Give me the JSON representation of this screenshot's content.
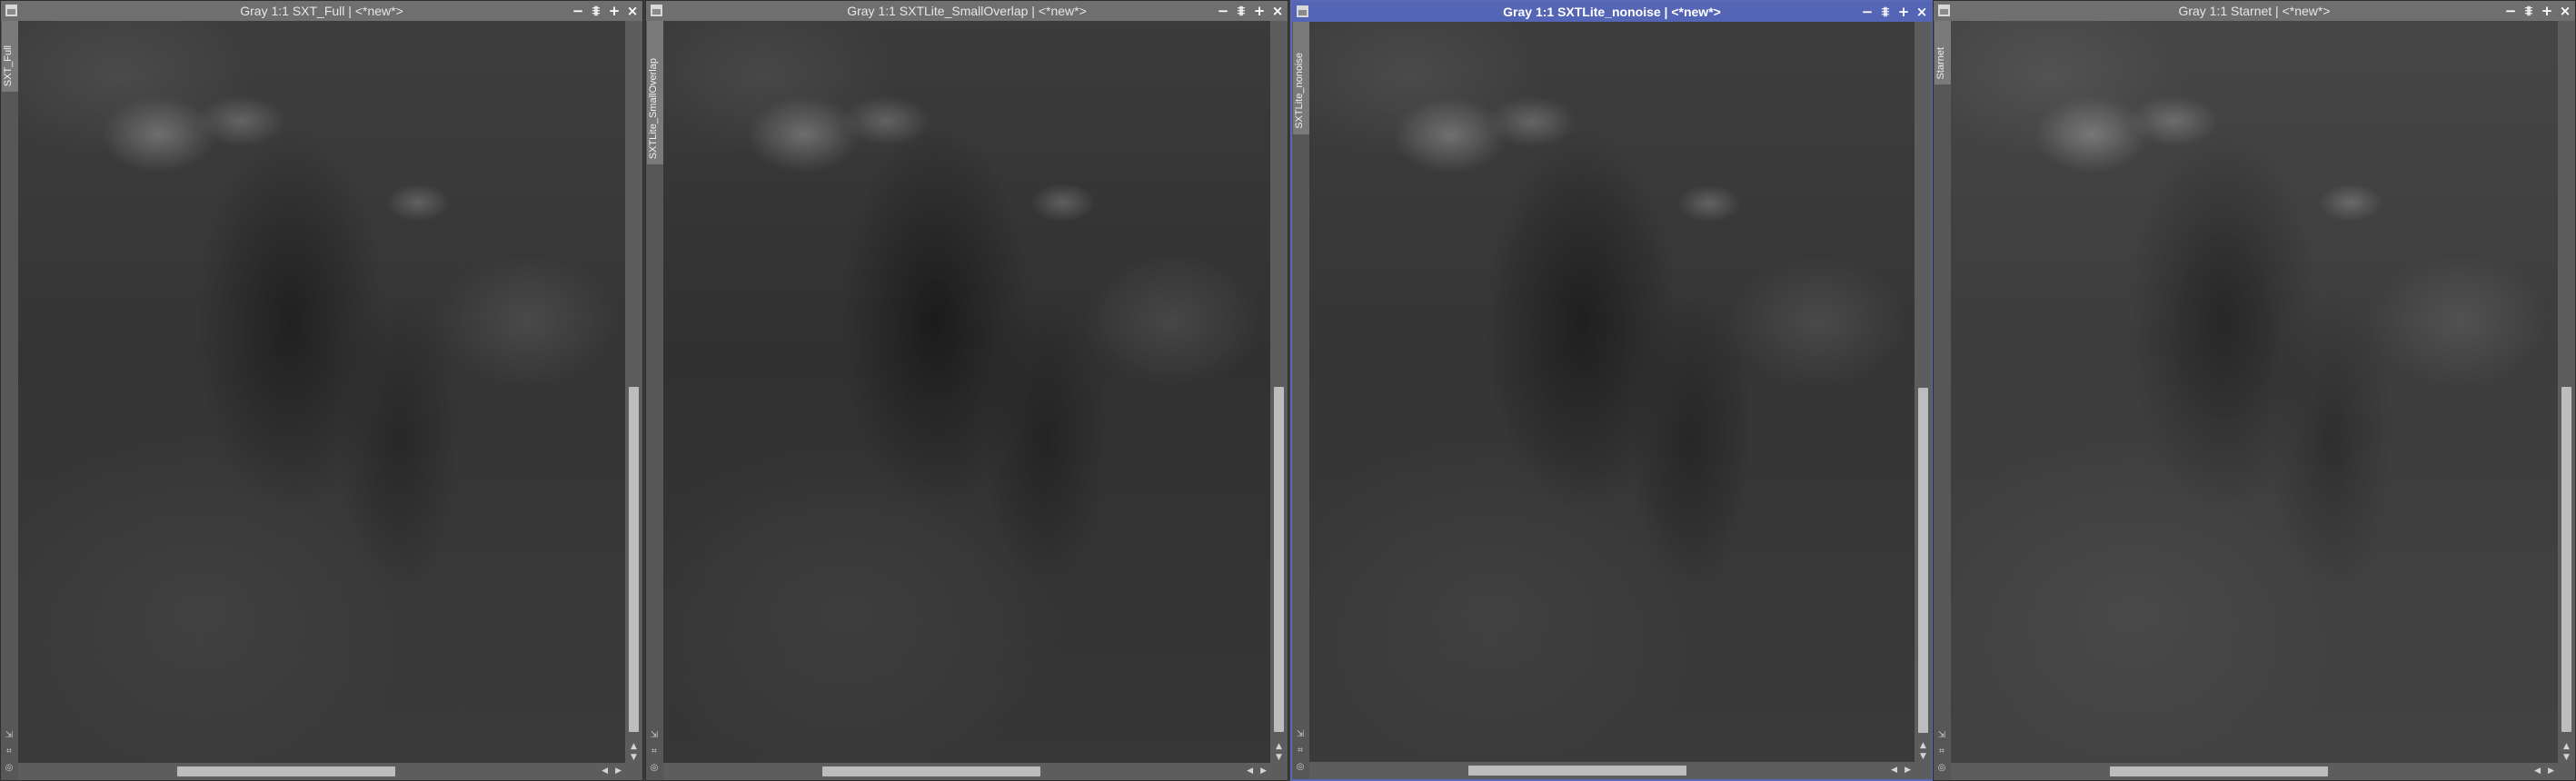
{
  "windows": [
    {
      "title": "Gray 1:1 SXT_Full | <*new*>",
      "identifier": "SXT_Full",
      "active": false
    },
    {
      "title": "Gray 1:1 SXTLite_SmallOverlap | <*new*>",
      "identifier": "SXTLite_SmallOverlap",
      "active": false
    },
    {
      "title": "Gray 1:1 SXTLite_nonoise | <*new*>",
      "identifier": "SXTLite_nonoise",
      "active": true
    },
    {
      "title": "Gray 1:1 Starnet | <*new*>",
      "identifier": "Starnet",
      "active": false
    }
  ],
  "title_buttons": {
    "minimize": "−",
    "shade": "⩨",
    "maximize": "+",
    "close": "×"
  },
  "icons": {
    "window_menu": "window-menu-icon",
    "minimize": "minimize-icon",
    "shade": "shade-icon",
    "maximize": "maximize-icon",
    "close": "close-icon",
    "fit": "fit-view-icon",
    "zoom": "zoom-icon",
    "preview": "preview-icon",
    "scroll_up": "arrow-up-icon",
    "scroll_down": "arrow-down-icon",
    "scroll_left": "arrow-left-icon",
    "scroll_right": "arrow-right-icon"
  },
  "image_colors": {
    "active_border": "#5a6ab8",
    "active_title": "#5565b5"
  }
}
